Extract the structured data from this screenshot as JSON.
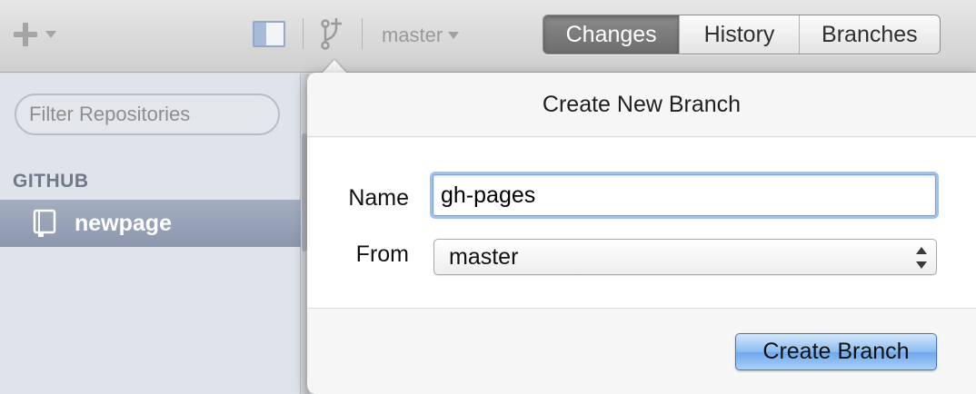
{
  "toolbar": {
    "add_icon": "plus-icon",
    "sidebar_toggle_icon": "sidebar-toggle-icon",
    "branch_icon": "branch-add-icon",
    "branch_select_label": "master",
    "tabs": [
      {
        "label": "Changes",
        "active": true
      },
      {
        "label": "History",
        "active": false
      },
      {
        "label": "Branches",
        "active": false
      }
    ]
  },
  "sidebar": {
    "filter_placeholder": "Filter Repositories",
    "section_label": "GITHUB",
    "repos": [
      {
        "label": "newpage",
        "icon": "repo-book-icon",
        "selected": true
      }
    ]
  },
  "popover": {
    "title": "Create New Branch",
    "name_label": "Name",
    "name_value": "gh-pages",
    "from_label": "From",
    "from_value": "master",
    "submit_label": "Create Branch"
  },
  "colors": {
    "active_tab": "#7a7a7a",
    "selected_repo": "#97a1b6",
    "focus_ring": "#9fc1ec",
    "primary_button": "#8cbcf1"
  }
}
